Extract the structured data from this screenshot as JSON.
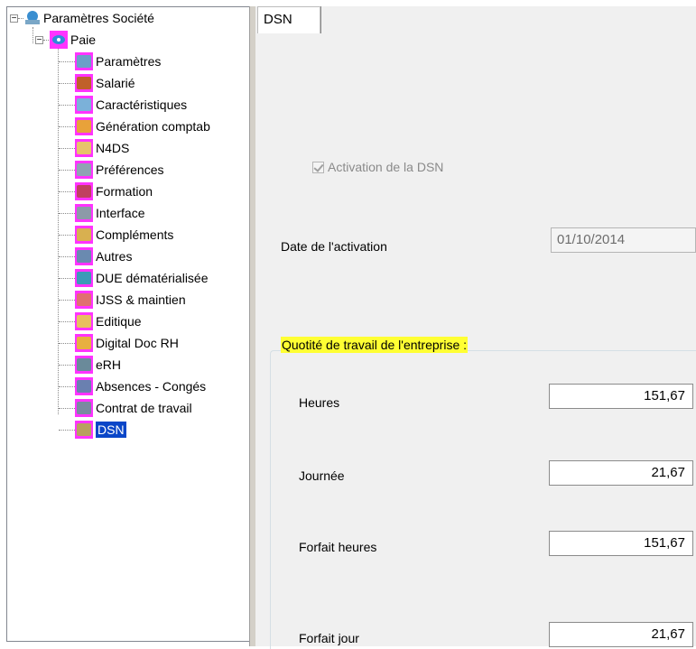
{
  "tree": {
    "root": {
      "label": "Paramètres Société",
      "expander": "−"
    },
    "paie": {
      "label": "Paie",
      "expander": "−"
    },
    "items": [
      {
        "label": "Paramètres",
        "icon": "settings-icon",
        "color": "#6aa0c8"
      },
      {
        "label": "Salarié",
        "icon": "employee-icon",
        "color": "#c0602a"
      },
      {
        "label": "Caractéristiques",
        "icon": "features-icon",
        "color": "#7bb1d9"
      },
      {
        "label": "Génération comptab",
        "icon": "document-icon",
        "color": "#e8a23a"
      },
      {
        "label": "N4DS",
        "icon": "folder-icon",
        "color": "#e7c36b"
      },
      {
        "label": "Préférences",
        "icon": "preferences-icon",
        "color": "#8fa3b3"
      },
      {
        "label": "Formation",
        "icon": "training-icon",
        "color": "#c04060"
      },
      {
        "label": "Interface",
        "icon": "interface-icon",
        "color": "#8c9aa8"
      },
      {
        "label": "Compléments",
        "icon": "complements-icon",
        "color": "#d8b050"
      },
      {
        "label": "Autres",
        "icon": "others-icon",
        "color": "#6a8ab0"
      },
      {
        "label": "DUE dématérialisée",
        "icon": "due-icon",
        "color": "#3d9ab8"
      },
      {
        "label": "IJSS & maintien",
        "icon": "ijss-icon",
        "color": "#e07070"
      },
      {
        "label": "Editique",
        "icon": "editique-icon",
        "color": "#e8c060"
      },
      {
        "label": "Digital Doc RH",
        "icon": "digital-doc-icon",
        "color": "#e8b040"
      },
      {
        "label": "eRH",
        "icon": "erh-icon",
        "color": "#6a8a9a"
      },
      {
        "label": "Absences - Congés",
        "icon": "absences-icon",
        "color": "#6a80b0"
      },
      {
        "label": "Contrat de travail",
        "icon": "contract-icon",
        "color": "#7a8aa0"
      },
      {
        "label": "DSN",
        "icon": "dsn-icon",
        "color": "#b8a060",
        "selected": true
      }
    ]
  },
  "tab": {
    "label": "DSN"
  },
  "form": {
    "activation_label": "Activation de la DSN",
    "activation_checked": true,
    "date_label": "Date de l'activation",
    "date_value": "01/10/2014",
    "group_title": "Quotité de travail de l'entreprise :",
    "heures_label": "Heures",
    "heures_value": "151,67",
    "journee_label": "Journée",
    "journee_value": "21,67",
    "forfait_heures_label": "Forfait heures",
    "forfait_heures_value": "151,67",
    "forfait_jour_label": "Forfait jour",
    "forfait_jour_value": "21,67"
  },
  "colors": {
    "selection": "#0a46c8",
    "highlight": "#ffff33",
    "icon_bg": "#ff33ff"
  }
}
